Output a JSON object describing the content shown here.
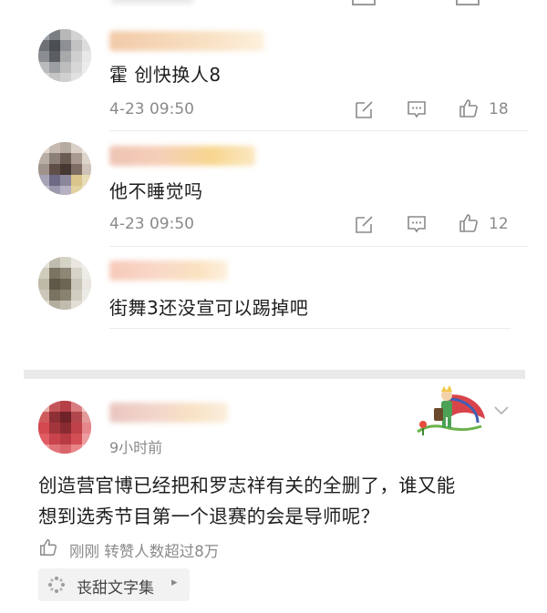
{
  "comments": [
    {
      "text": "霍 创快换人8",
      "time": "4-23 09:50",
      "likes": "18"
    },
    {
      "text": "他不睡觉吗",
      "time": "4-23 09:50",
      "likes": "12"
    },
    {
      "text": "街舞3还没宣可以踢掉吧"
    }
  ],
  "post": {
    "time": "9小时前",
    "text_line1": "创造营官博已经把和罗志祥有关的全删了，谁又能",
    "text_line2": "想到选秀节目第一个退赛的会是导师呢？",
    "like_status": "刚刚 转赞人数超过8万",
    "font_tag": "丧甜文字集",
    "font_tag_arrow": "▸"
  },
  "icons": [
    "edit-icon",
    "comment-icon",
    "thumbs-up-icon",
    "chevron-down-icon",
    "font-icon"
  ],
  "colors": {
    "meta_gray": "#8a8a8a",
    "separator": "#e6e6e6"
  }
}
